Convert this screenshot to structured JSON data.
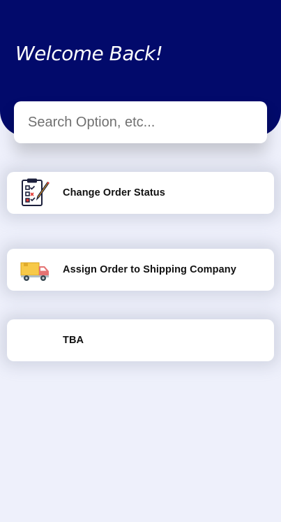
{
  "header": {
    "title": "Welcome Back!"
  },
  "search": {
    "placeholder": "Search Option, etc..."
  },
  "options": [
    {
      "label": "Change Order Status",
      "icon": "clipboard-checklist-icon"
    },
    {
      "label": "Assign Order to Shipping Company",
      "icon": "delivery-truck-icon"
    },
    {
      "label": "TBA",
      "icon": ""
    }
  ],
  "colors": {
    "header_bg": "#020a6b",
    "page_bg": "#eef0fb",
    "card_bg": "#ffffff"
  }
}
